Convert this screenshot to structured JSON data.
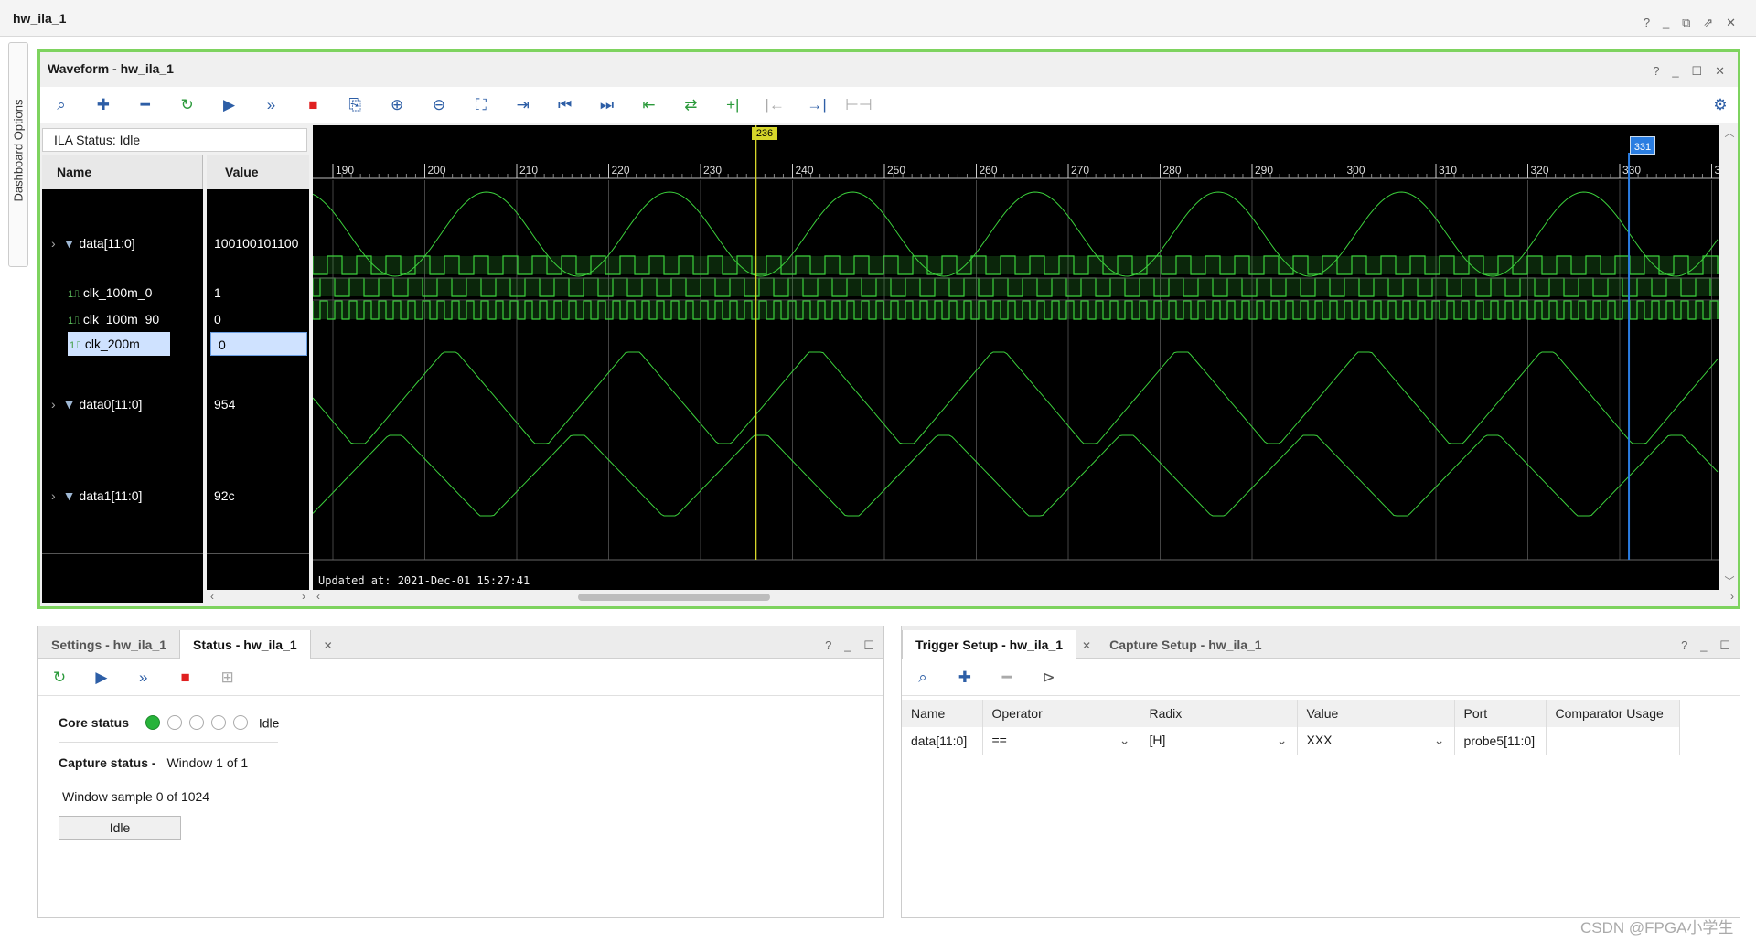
{
  "window": {
    "title": "hw_ila_1",
    "controls": [
      "?",
      "_",
      "⧉",
      "↗",
      "✕"
    ]
  },
  "side_tab": {
    "label": "Dashboard Options"
  },
  "waveform": {
    "title": "Waveform - hw_ila_1",
    "ila_status": "ILA Status:  Idle",
    "columns": {
      "name": "Name",
      "value": "Value"
    },
    "signals": [
      {
        "name": "data[11:0]",
        "value": "100100101100",
        "type": "bus"
      },
      {
        "name": "clk_100m_0",
        "value": "1",
        "type": "bit"
      },
      {
        "name": "clk_100m_90",
        "value": "0",
        "type": "bit"
      },
      {
        "name": "clk_200m",
        "value": "0",
        "type": "bit",
        "selected": true
      },
      {
        "name": "data0[11:0]",
        "value": "954",
        "type": "bus"
      },
      {
        "name": "data1[11:0]",
        "value": "92c",
        "type": "bus"
      }
    ],
    "ruler_ticks": [
      "190",
      "200",
      "210",
      "220",
      "230",
      "240",
      "250",
      "260",
      "270",
      "280",
      "290",
      "300",
      "310",
      "320",
      "330",
      "3"
    ],
    "cursor_yellow": "236",
    "cursor_blue": "331",
    "updated": "Updated at: 2021-Dec-01 15:27:41"
  },
  "status_panel": {
    "tabs": [
      "Settings - hw_ila_1",
      "Status - hw_ila_1"
    ],
    "core_status_label": "Core status",
    "core_status_value": "Idle",
    "capture_status_label": "Capture status -",
    "capture_status_value": "Window 1 of 1",
    "window_sample": "Window sample 0 of 1024",
    "state_button": "Idle"
  },
  "trigger_panel": {
    "tabs": [
      "Trigger Setup - hw_ila_1",
      "Capture Setup - hw_ila_1"
    ],
    "columns": [
      "Name",
      "Operator",
      "Radix",
      "Value",
      "Port",
      "Comparator Usage"
    ],
    "rows": [
      {
        "name": "data[11:0]",
        "operator": "==",
        "radix": "[H]",
        "value": "XXX",
        "port": "probe5[11:0]",
        "usage": ""
      }
    ]
  },
  "watermark": "CSDN @FPGA小学生",
  "colors": {
    "accent_green": "#7ed35f",
    "wave": "#3cd13c",
    "cursor_yellow": "#d6d62a",
    "cursor_blue": "#2a7de1"
  }
}
